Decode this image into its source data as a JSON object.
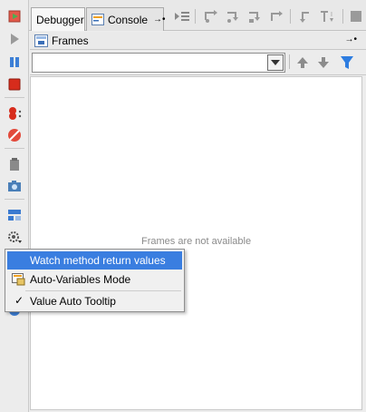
{
  "tabs": [
    {
      "label": "Debugger",
      "active": true
    },
    {
      "label": "Console",
      "active": false
    }
  ],
  "frames": {
    "title": "Frames",
    "empty_message": "Frames are not available",
    "selected_frame": ""
  },
  "popup_menu": {
    "items": [
      {
        "label": "Watch method return values",
        "checked": false,
        "selected": true,
        "icon": "none"
      },
      {
        "label": "Auto-Variables Mode",
        "checked": false,
        "selected": false,
        "icon": "auto-variables-icon"
      },
      {
        "label": "Value Auto Tooltip",
        "checked": true,
        "selected": false,
        "icon": "none"
      }
    ],
    "check_glyph": "✓"
  },
  "colors": {
    "selection": "#3a7ee0",
    "filter_icon": "#2e7de0",
    "stop_red": "#d72c1c",
    "resume_green": "#3e9b36"
  }
}
